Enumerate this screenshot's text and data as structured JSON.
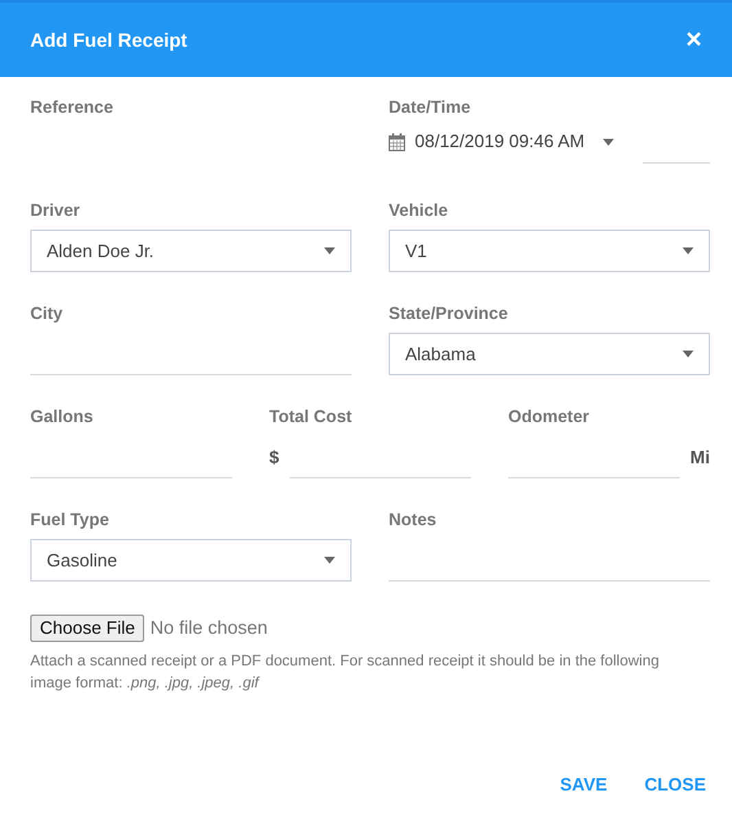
{
  "dialog": {
    "title": "Add Fuel Receipt",
    "close_glyph": "×"
  },
  "rows": [
    [
      {
        "kind": "blank",
        "label": "Reference"
      },
      {
        "kind": "datetime",
        "label": "Date/Time",
        "value": "08/12/2019 09:46 AM"
      }
    ],
    [
      {
        "kind": "select",
        "label": "Driver",
        "value": "Alden Doe Jr."
      },
      {
        "kind": "select",
        "label": "Vehicle",
        "value": "V1"
      }
    ],
    [
      {
        "kind": "text",
        "label": "City"
      },
      {
        "kind": "select",
        "label": "State/Province",
        "value": "Alabama"
      }
    ],
    [
      {
        "kind": "text",
        "label": "Gallons"
      },
      {
        "kind": "text",
        "label": "Total Cost",
        "prefix": "$"
      },
      {
        "kind": "text",
        "label": "Odometer",
        "suffix": "Mi"
      }
    ],
    [
      {
        "kind": "select",
        "label": "Fuel Type",
        "value": "Gasoline"
      },
      {
        "kind": "text",
        "label": "Notes"
      }
    ]
  ],
  "file": {
    "button": "Choose File",
    "status": "No file chosen",
    "help": "Attach a scanned receipt or a PDF document. For scanned receipt it should be in the following image format: *.png, .jpg, .jpeg, .gif*"
  },
  "buttons": [
    "SAVE",
    "CLOSE"
  ]
}
